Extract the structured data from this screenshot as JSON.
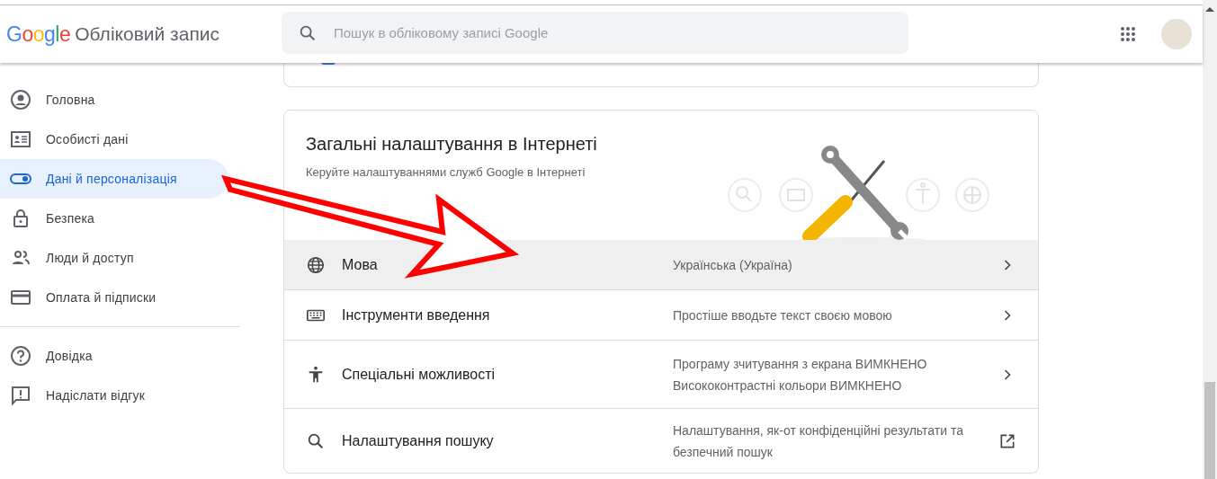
{
  "header": {
    "logo": "Google",
    "title": "Обліковий запис",
    "search": {
      "placeholder": "Пошук в обліковому записі Google"
    }
  },
  "sidebar": {
    "items": [
      {
        "label": "Головна",
        "selected": false
      },
      {
        "label": "Особисті дані",
        "selected": false
      },
      {
        "label": "Дані й персоналізація",
        "selected": true
      },
      {
        "label": "Безпека",
        "selected": false
      },
      {
        "label": "Люди й доступ",
        "selected": false
      },
      {
        "label": "Оплата й підписки",
        "selected": false
      }
    ],
    "footer_items": [
      {
        "label": "Довідка",
        "selected": false
      },
      {
        "label": "Надіслати відгук",
        "selected": false
      }
    ]
  },
  "card": {
    "title": "Загальні налаштування в Інтернеті",
    "subtitle": "Керуйте налаштуваннями служб Google в Інтернеті",
    "rows": [
      {
        "label": "Мова",
        "values": [
          "Українська (Україна)"
        ],
        "highlighted": true,
        "kind": "chevron"
      },
      {
        "label": "Інструменти введення",
        "values": [
          "Простіше вводьте текст своєю мовою"
        ],
        "highlighted": false,
        "kind": "chevron"
      },
      {
        "label": "Спеціальні можливості",
        "values": [
          "Програму зчитування з екрана ВИМКНЕНО",
          "Висококонтрастні кольори ВИМКНЕНО"
        ],
        "highlighted": false,
        "kind": "chevron"
      },
      {
        "label": "Налаштування пошуку",
        "values": [
          "Налаштування, як-от конфіденційні результати та безпечний пошук"
        ],
        "highlighted": false,
        "kind": "external"
      }
    ]
  },
  "annotation": {
    "kind": "arrow"
  }
}
